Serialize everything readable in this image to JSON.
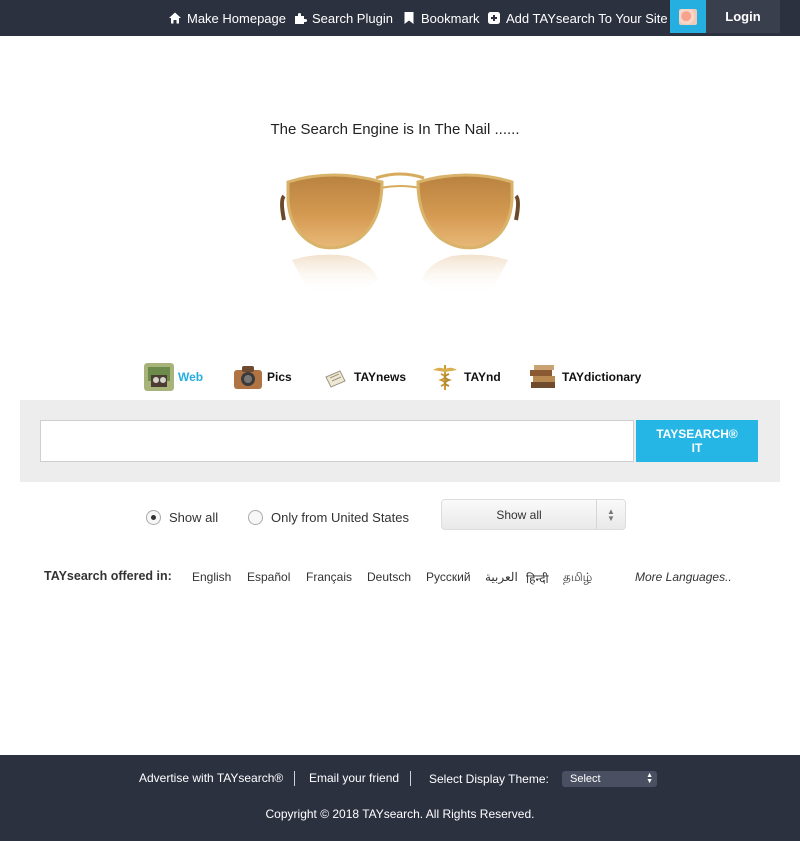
{
  "topbar": {
    "links": [
      {
        "label": "Make Homepage",
        "icon": "home-icon"
      },
      {
        "label": "Search Plugin",
        "icon": "puzzle-icon"
      },
      {
        "label": "Bookmark",
        "icon": "bookmark-icon"
      },
      {
        "label": "Add TAYsearch To Your Site",
        "icon": "plus-square-icon"
      }
    ],
    "login_label": "Login"
  },
  "hero": {
    "tagline": "The Search Engine is In The Nail ......"
  },
  "tabs": [
    {
      "label": "Web",
      "active": true
    },
    {
      "label": "Pics",
      "active": false
    },
    {
      "label": "TAYnews",
      "active": false
    },
    {
      "label": "TAYnd",
      "active": false
    },
    {
      "label": "TAYdictionary",
      "active": false
    }
  ],
  "search": {
    "value": "",
    "button_label": "TAYSEARCH® IT"
  },
  "filters": {
    "radio_all": "Show all",
    "radio_country": "Only from United States",
    "select_value": "Show all"
  },
  "languages": {
    "title": "TAYsearch offered in:",
    "items": [
      "English",
      "Español",
      "Français",
      "Deutsch",
      "Русский",
      "العربية",
      "हिन्दी",
      "தமிழ்"
    ],
    "more": "More Languages.."
  },
  "footer": {
    "advertise": "Advertise with TAYsearch®",
    "email": "Email your friend",
    "theme_label": "Select Display Theme:",
    "theme_select": "Select",
    "copyright": "Copyright © 2018 TAYsearch. All Rights Reserved."
  },
  "colors": {
    "bar": "#2c3140",
    "accent": "#25b6e6"
  }
}
